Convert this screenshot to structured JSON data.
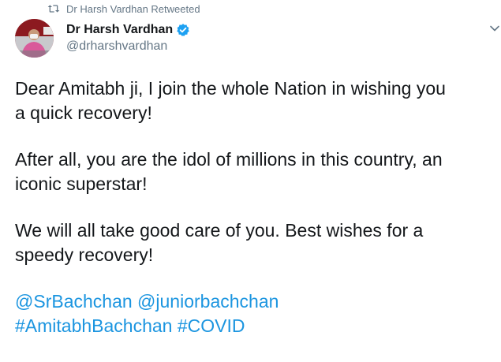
{
  "retweet": {
    "label": "Dr Harsh Vardhan Retweeted"
  },
  "author": {
    "display_name": "Dr Harsh Vardhan",
    "handle": "@drharshvardhan",
    "verified": true
  },
  "tweet": {
    "paragraph1_line1": "Dear Amitabh ji, I join the whole Nation in wishing you",
    "paragraph1_line2": "a quick recovery!",
    "paragraph2_line1": "After all, you are the idol of millions in this country, an",
    "paragraph2_line2": "iconic superstar!",
    "paragraph3_line1": "We will all take good care of you. Best wishes for a",
    "paragraph3_line2": "speedy recovery!",
    "mention1": "@SrBachchan",
    "mention2": "@juniorbachchan",
    "hashtag1": "#AmitabhBachchan",
    "hashtag2": "#COVID"
  },
  "colors": {
    "link": "#1b95e0",
    "secondary_text": "#657786",
    "primary_text": "#14171a",
    "verified_badge": "#1da1f2"
  },
  "icons": {
    "retweet": "retweet-icon",
    "verified": "verified-icon",
    "more": "chevron-down-icon"
  }
}
